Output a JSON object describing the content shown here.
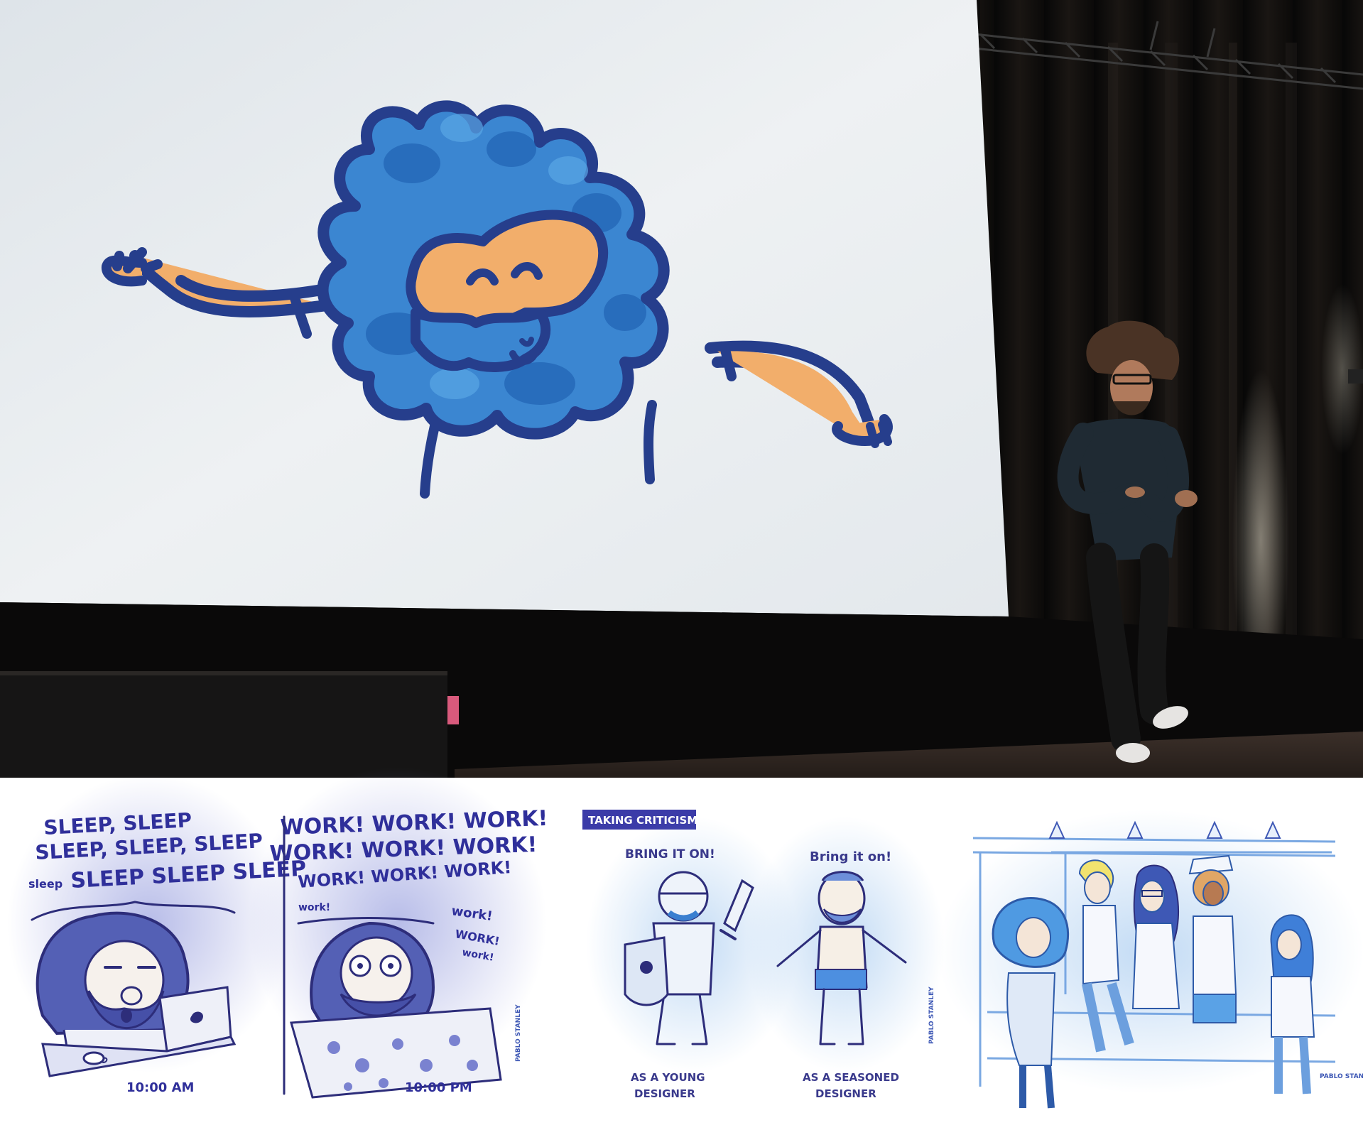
{
  "comic1": {
    "panel1_lines": [
      "SLEEP, SLEEP",
      "SLEEP, SLEEP, SLEEP",
      "SLEEP SLEEP SLEEP"
    ],
    "panel1_small_word": "sleep",
    "panel1_time": "10:00 AM",
    "panel2_lines": [
      "WORK! WORK! WORK!",
      "WORK! WORK! WORK!",
      "WORK! WORK! WORK!"
    ],
    "panel2_small_words": [
      "work!",
      "work!",
      "WORK!",
      "work!"
    ],
    "panel2_time": "10:00 PM",
    "signature": "PABLO STANLEY"
  },
  "comic2": {
    "title": "TAKING CRITICISM",
    "left_speech": "BRING IT ON!",
    "right_speech": "Bring it on!",
    "left_caption": [
      "AS A YOUNG",
      "DESIGNER"
    ],
    "right_caption": [
      "AS A SEASONED",
      "DESIGNER"
    ],
    "signature": "PABLO STANLEY"
  },
  "comic3": {
    "signature": "PABLO STANLEY"
  }
}
